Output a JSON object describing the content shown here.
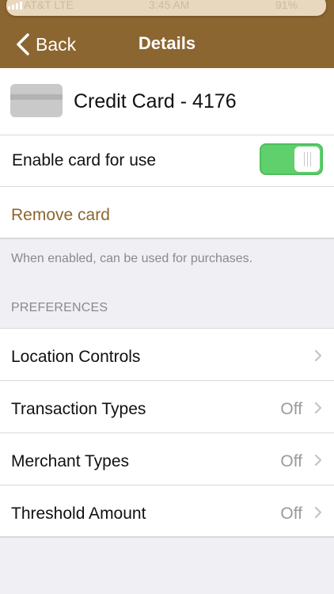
{
  "nav": {
    "back_label": "Back",
    "title": "Details",
    "bar_color": "#8c6630"
  },
  "status_bar": {
    "carrier": "AT&T LTE",
    "time": "3:45 AM",
    "battery": "91%"
  },
  "card": {
    "name": "Credit Card - 4176",
    "icon": "credit-card-icon"
  },
  "enable": {
    "label": "Enable card for use",
    "enabled": true,
    "toggle_color": "#5fd06c"
  },
  "remove": {
    "label": "Remove card",
    "color": "#8c6630"
  },
  "hint_text": "When enabled, can be used for purchases.",
  "preferences": {
    "header": "PREFERENCES",
    "items": [
      {
        "label": "Location Controls",
        "value": ""
      },
      {
        "label": "Transaction Types",
        "value": "Off"
      },
      {
        "label": "Merchant Types",
        "value": "Off"
      },
      {
        "label": "Threshold Amount",
        "value": "Off"
      }
    ]
  }
}
